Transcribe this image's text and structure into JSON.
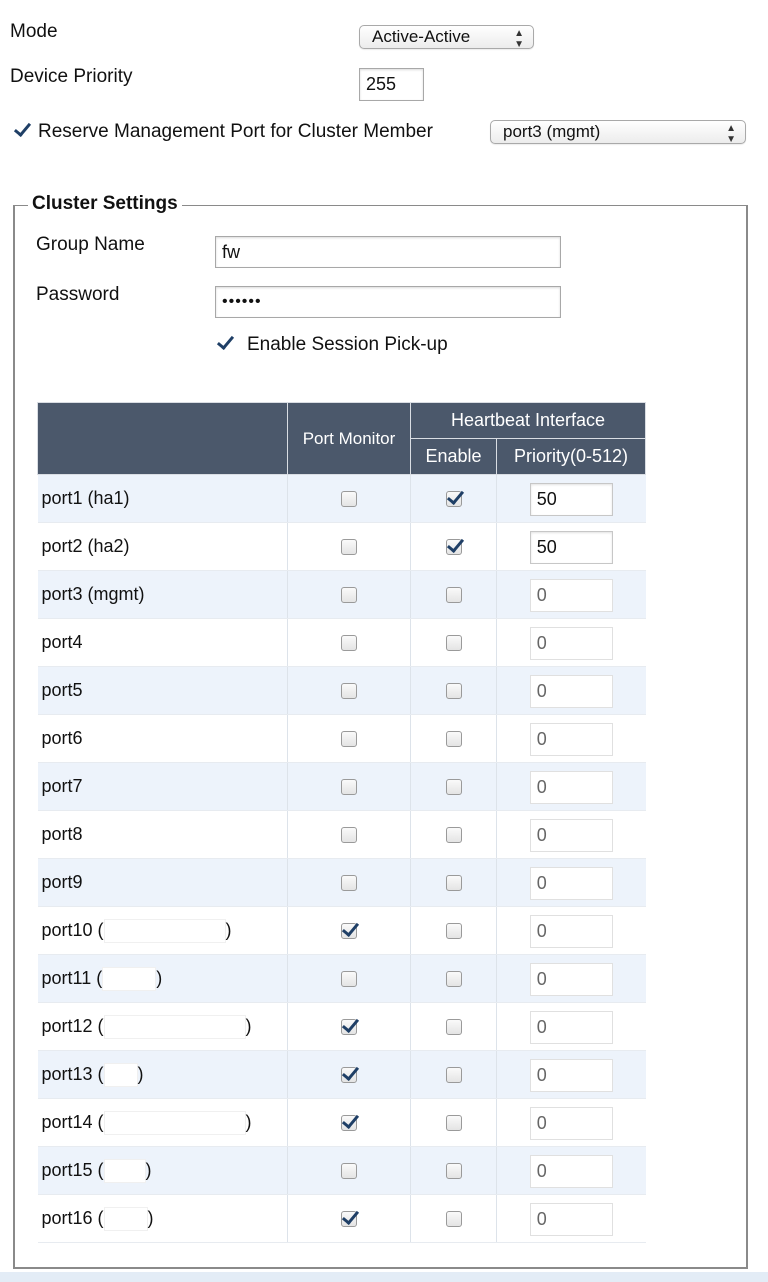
{
  "mode": {
    "label": "Mode",
    "value": "Active-Active"
  },
  "device_priority": {
    "label": "Device Priority",
    "value": "255"
  },
  "reserve_mgmt": {
    "label": "Reserve Management Port for Cluster Member",
    "checked": true,
    "value": "port3 (mgmt)"
  },
  "cluster": {
    "legend": "Cluster Settings",
    "group_name_label": "Group Name",
    "group_name_value": "fw",
    "password_label": "Password",
    "password_value": "••••••",
    "session_pickup_label": "Enable Session Pick-up",
    "session_pickup_checked": true
  },
  "table": {
    "header_port_monitor": "Port Monitor",
    "header_heartbeat": "Heartbeat Interface",
    "header_enable": "Enable",
    "header_priority": "Priority(0-512)",
    "rows": [
      {
        "port": "port1 (ha1)",
        "monitor": false,
        "enable": true,
        "priority": "50"
      },
      {
        "port": "port2 (ha2)",
        "monitor": false,
        "enable": true,
        "priority": "50"
      },
      {
        "port": "port3 (mgmt)",
        "monitor": false,
        "enable": false,
        "priority": "0"
      },
      {
        "port": "port4",
        "monitor": false,
        "enable": false,
        "priority": "0"
      },
      {
        "port": "port5",
        "monitor": false,
        "enable": false,
        "priority": "0"
      },
      {
        "port": "port6",
        "monitor": false,
        "enable": false,
        "priority": "0"
      },
      {
        "port": "port7",
        "monitor": false,
        "enable": false,
        "priority": "0"
      },
      {
        "port": "port8",
        "monitor": false,
        "enable": false,
        "priority": "0"
      },
      {
        "port": "port9",
        "monitor": false,
        "enable": false,
        "priority": "0"
      },
      {
        "port": "port10 (",
        "suffix": ")",
        "monitor": true,
        "enable": false,
        "priority": "0"
      },
      {
        "port": "port11 (",
        "suffix": ")",
        "monitor": false,
        "enable": false,
        "priority": "0"
      },
      {
        "port": "port12 (",
        "suffix": ")",
        "monitor": true,
        "enable": false,
        "priority": "0"
      },
      {
        "port": "port13 (",
        "suffix": ")",
        "monitor": true,
        "enable": false,
        "priority": "0"
      },
      {
        "port": "port14 (",
        "suffix": ")",
        "monitor": true,
        "enable": false,
        "priority": "0"
      },
      {
        "port": "port15 (",
        "suffix": ")",
        "monitor": false,
        "enable": false,
        "priority": "0"
      },
      {
        "port": "port16 (",
        "suffix": ")",
        "monitor": true,
        "enable": false,
        "priority": "0"
      }
    ]
  }
}
